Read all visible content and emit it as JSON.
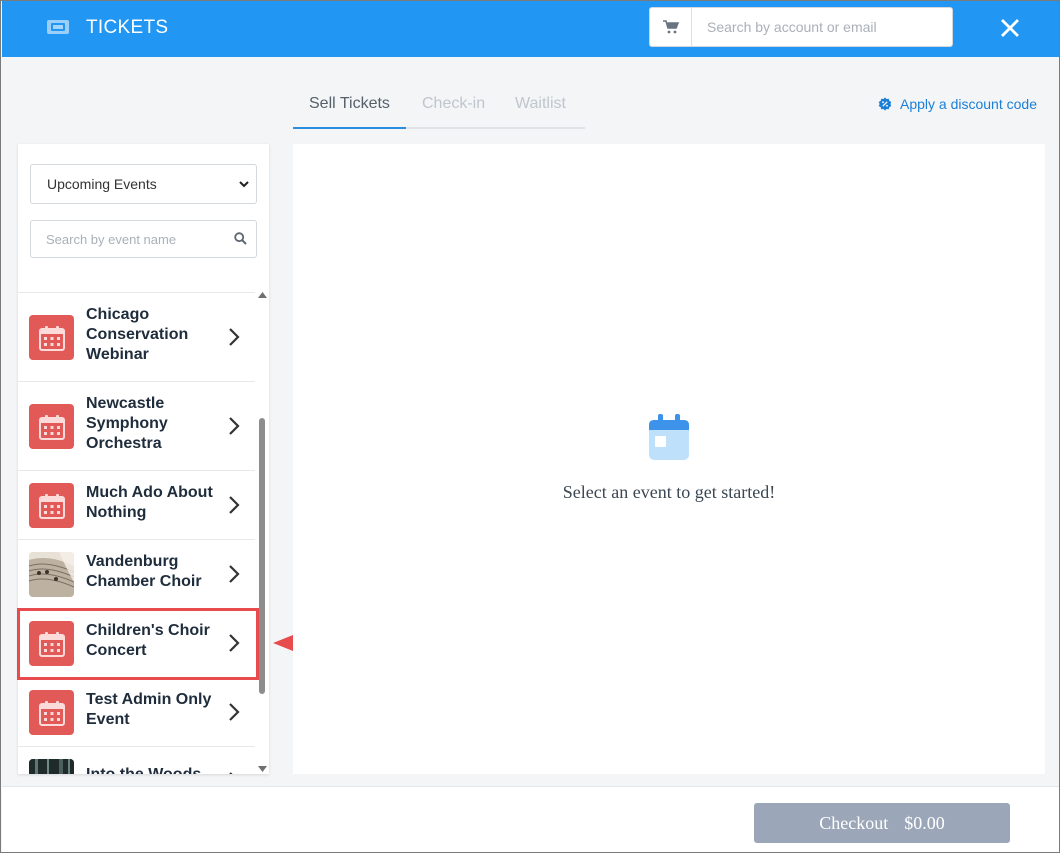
{
  "header": {
    "title": "TICKETS",
    "account_search_placeholder": "Search by account or email",
    "icons": [
      "ticket-icon",
      "cart-icon",
      "close-icon"
    ]
  },
  "tabs": [
    {
      "label": "Sell Tickets",
      "active": true
    },
    {
      "label": "Check-in",
      "active": false
    },
    {
      "label": "Waitlist",
      "active": false
    }
  ],
  "discount": {
    "label": "Apply a discount code"
  },
  "events_panel": {
    "filter_selected": "Upcoming Events",
    "search_placeholder": "Search by event name",
    "events": [
      {
        "name": "Chicago Conservation Webinar",
        "thumb": "calendar-icon"
      },
      {
        "name": "Newcastle Symphony Orchestra",
        "thumb": "calendar-icon"
      },
      {
        "name": "Much Ado About Nothing",
        "thumb": "calendar-icon"
      },
      {
        "name": "Vandenburg Chamber Choir",
        "thumb": "sheet-music-photo"
      },
      {
        "name": "Children's Choir Concert",
        "thumb": "calendar-icon",
        "highlighted": true
      },
      {
        "name": "Test Admin Only Event",
        "thumb": "calendar-icon"
      },
      {
        "name": "Into the Woods",
        "thumb": "forest-photo"
      }
    ]
  },
  "main": {
    "prompt": "Select an event to get started!"
  },
  "footer": {
    "checkout_label": "Checkout",
    "checkout_total": "$0.00"
  },
  "colors": {
    "header_bg": "#2196f3",
    "calendar_thumb": "#e25a57",
    "highlight_box": "#e84b4e",
    "checkout_bg": "#9ba7b9",
    "link": "#1b7fd6"
  }
}
